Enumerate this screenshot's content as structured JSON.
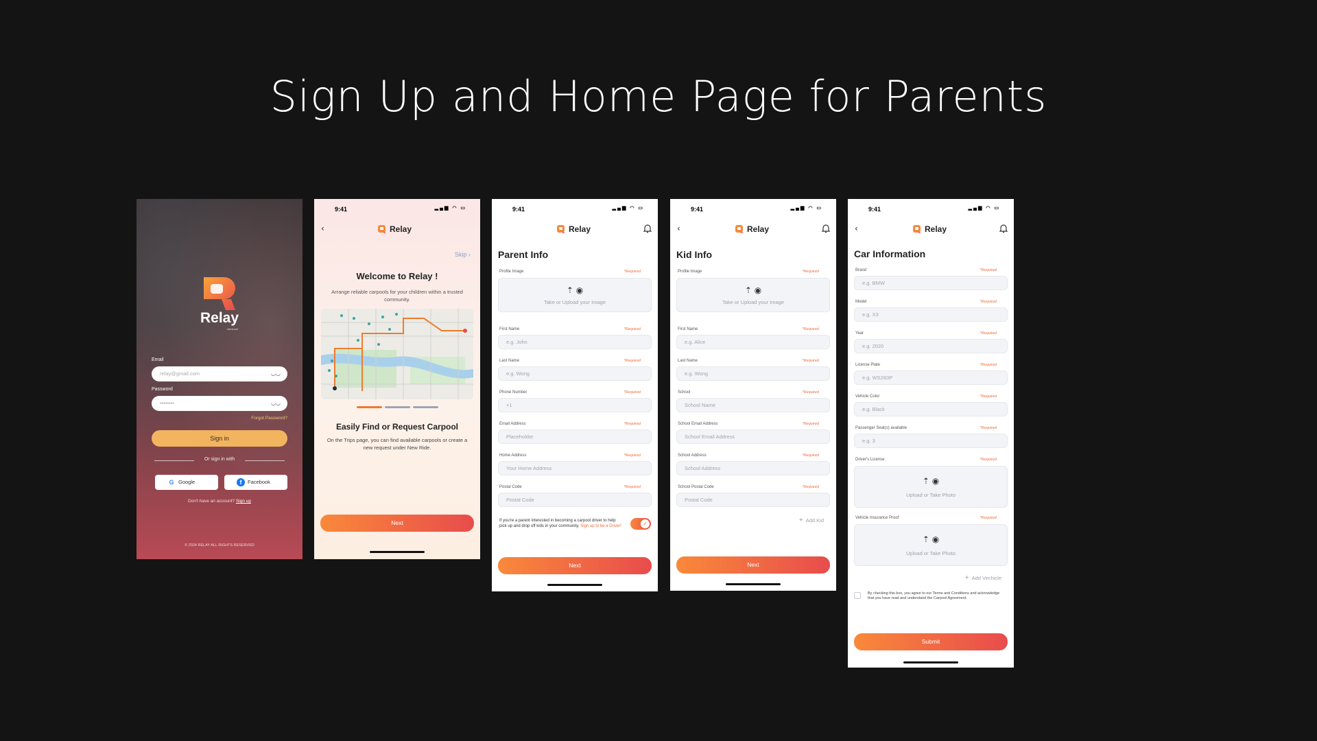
{
  "page": {
    "title": "Sign Up and Home Page for Parents"
  },
  "brand": {
    "name": "Relay",
    "tagline": "rideshare"
  },
  "login": {
    "email_label": "Email",
    "email_placeholder": "relay@gmail.com",
    "password_label": "Password",
    "password_value": "••••••••",
    "forgot": "Forgot Password?",
    "signin": "Sign in",
    "or": "Or sign in with",
    "google": "Google",
    "facebook": "Facebook",
    "no_account": "Don't have an account?",
    "signup": "Sign up",
    "copyright": "© 2024 RELAY ALL RIGHTS RESERVED"
  },
  "status": {
    "time_a": "9:41",
    "time_b": "9:41"
  },
  "onboarding": {
    "skip": "Skip",
    "title": "Welcome to Relay !",
    "subtitle": "Arrange reliable carpools for your children within a trusted community.",
    "feature_title": "Easily Find or Request Carpool",
    "feature_text": "On the Trips page, you can find available carpools or create a new request under New Ride.",
    "next": "Next",
    "active_page": 1,
    "page_count": 3
  },
  "common": {
    "required": "*Required"
  },
  "parent": {
    "title": "Parent Info",
    "profile_label": "Profile Image",
    "upload_caption": "Take or Upload your Image",
    "fields": [
      {
        "label": "First Name",
        "placeholder": "e.g. John"
      },
      {
        "label": "Last Name",
        "placeholder": "e.g. Wong"
      },
      {
        "label": "Phone Number",
        "placeholder": "+1"
      },
      {
        "label": "Email Address",
        "placeholder": "Placeholder"
      },
      {
        "label": "Home Address",
        "placeholder": "Your Home Address"
      },
      {
        "label": "Postal Code",
        "placeholder": "Postal Code"
      }
    ],
    "driver_note": "If you're a parent interested in becoming a carpool driver to help pick up and drop off kids in your community,",
    "driver_link": "Sign up to be a Driver!",
    "next": "Next"
  },
  "kid": {
    "title": "Kid Info",
    "profile_label": "Profile Image",
    "upload_caption": "Take or Upload your Image",
    "fields": [
      {
        "label": "First Name",
        "placeholder": "e.g. Alice"
      },
      {
        "label": "Last Name",
        "placeholder": "e.g. Wong"
      },
      {
        "label": "School",
        "placeholder": "School Name"
      },
      {
        "label": "School Email Address",
        "placeholder": "School Email Address"
      },
      {
        "label": "School Address",
        "placeholder": "School Address"
      },
      {
        "label": "School Postal Code",
        "placeholder": "Postal Code"
      }
    ],
    "add": "Add Kid",
    "next": "Next"
  },
  "car": {
    "title": "Car Information",
    "fields": [
      {
        "label": "Brand",
        "placeholder": "e.g. BMW"
      },
      {
        "label": "Model",
        "placeholder": "e.g. X3"
      },
      {
        "label": "Year",
        "placeholder": "e.g. 2020"
      },
      {
        "label": "License Plate",
        "placeholder": "e.g. WS283P"
      },
      {
        "label": "Vehicle Color",
        "placeholder": "e.g. Black"
      },
      {
        "label": "Passenger Seat(s) available",
        "placeholder": "e.g. 3"
      }
    ],
    "license_label": "Driver's License",
    "insurance_label": "Vehicle Insurance Proof",
    "upload_caption": "Upload or Take Photo",
    "add": "Add Vechicle",
    "terms": "By checking this box, you agree to our Terms and Conditions and acknowledge that you have read and understand the Carpool Agreement.",
    "submit": "Submit"
  },
  "colors": {
    "accent_start": "#f9893a",
    "accent_end": "#e84c4c",
    "signin": "#f2b45e",
    "background": "#141414"
  }
}
